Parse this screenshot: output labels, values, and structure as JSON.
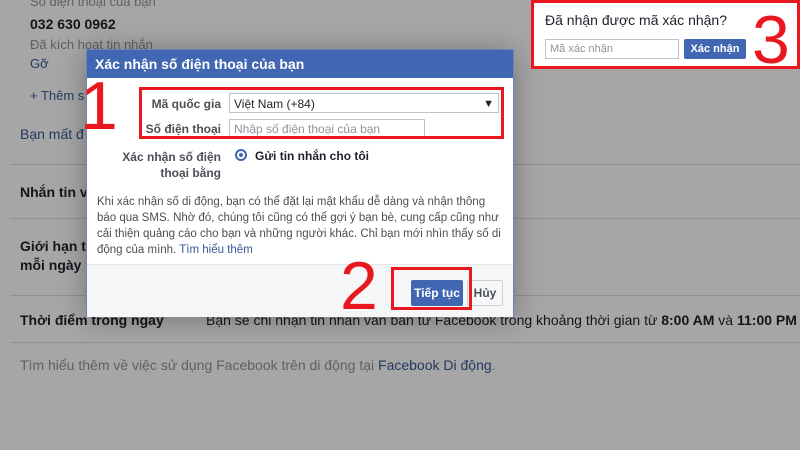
{
  "background": {
    "phone_label": "Số điện thoại của bạn",
    "phone_number": "032 630 0962",
    "activated_text": "Đã kích hoạt tin nhắn",
    "remove_link": "Gỡ",
    "add_more": "+ Thêm s",
    "lost_phone": "Bạn mất đ",
    "text_messages": "Nhắn tin v",
    "daily_limit_1": "Giới hạn t",
    "daily_limit_2": "mỗi ngày",
    "time_of_day_label": "Thời điểm trong ngày",
    "time_desc_1": "Bạn sẽ chỉ nhận tin nhắn văn bản từ Facebook trong khoảng thời gian từ",
    "time_from": "8:00 AM",
    "time_and": "và",
    "time_to": "11:00 PM",
    "footer_text": "Tìm hiểu thêm về việc sử dụng Facebook trên di động tại",
    "footer_link": "Facebook Di động",
    "footer_period": "."
  },
  "dialog": {
    "title": "Xác nhận số điện thoại của bạn",
    "country_label": "Mã quốc gia",
    "country_value": "Việt Nam (+84)",
    "phone_label": "Số điện thoại",
    "phone_placeholder": "Nhập số điện thoại của bạn",
    "verify_by_label_1": "Xác nhận số điện",
    "verify_by_label_2": "thoại bằng",
    "verify_option": "Gửi tin nhắn cho tôi",
    "description": "Khi xác nhận số di động, bạn có thể đặt lại mật khẩu dễ dàng và nhận thông báo qua SMS. Nhờ đó, chúng tôi cũng có thể gợi ý bạn bè, cung cấp cũng như cải thiện quảng cáo cho bạn và những người khác. Chỉ bạn mới nhìn thấy số di động của mình.",
    "learn_more": "Tìm hiểu thêm",
    "continue_button": "Tiếp tục",
    "cancel_button": "Hủy"
  },
  "confirm_code": {
    "question": "Đã nhận được mã xác nhận?",
    "placeholder": "Mã xác nhận",
    "button": "Xác nhận"
  },
  "annotations": {
    "step1": "1",
    "step2": "2",
    "step3": "3",
    "color": "#e8181e"
  }
}
